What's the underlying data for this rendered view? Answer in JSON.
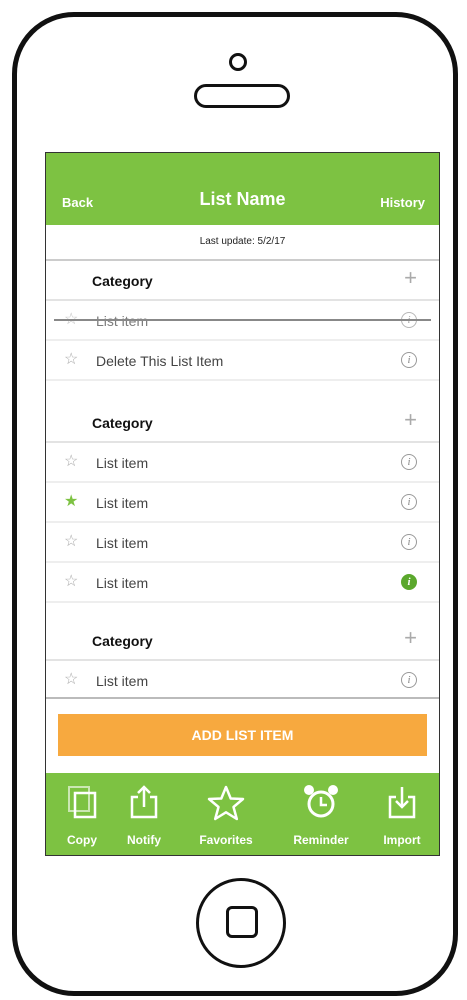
{
  "navbar": {
    "back": "Back",
    "title": "List Name",
    "history": "History"
  },
  "last_update": "Last update: 5/2/17",
  "sections": [
    {
      "category": "Category",
      "items": [
        {
          "label": "List item",
          "starred": false,
          "info_active": false,
          "struck": true
        },
        {
          "label": "Delete This List Item",
          "starred": false,
          "info_active": false,
          "struck": false
        }
      ]
    },
    {
      "category": "Category",
      "items": [
        {
          "label": "List item",
          "starred": false,
          "info_active": false,
          "struck": false
        },
        {
          "label": "List item",
          "starred": true,
          "info_active": false,
          "struck": false
        },
        {
          "label": "List item",
          "starred": false,
          "info_active": false,
          "struck": false
        },
        {
          "label": "List item",
          "starred": false,
          "info_active": true,
          "struck": false
        }
      ]
    },
    {
      "category": "Category",
      "items": [
        {
          "label": "List item",
          "starred": false,
          "info_active": false,
          "struck": false
        }
      ]
    }
  ],
  "add_button": "ADD LIST ITEM",
  "tabs": [
    {
      "label": "Copy",
      "icon": "copy-icon"
    },
    {
      "label": "Notify",
      "icon": "share-icon"
    },
    {
      "label": "Favorites",
      "icon": "star-icon"
    },
    {
      "label": "Reminder",
      "icon": "alarm-clock-icon"
    },
    {
      "label": "Import",
      "icon": "import-icon"
    }
  ],
  "colors": {
    "green": "#7dc242",
    "orange": "#f7a93f",
    "info_active": "#5ba82d"
  }
}
